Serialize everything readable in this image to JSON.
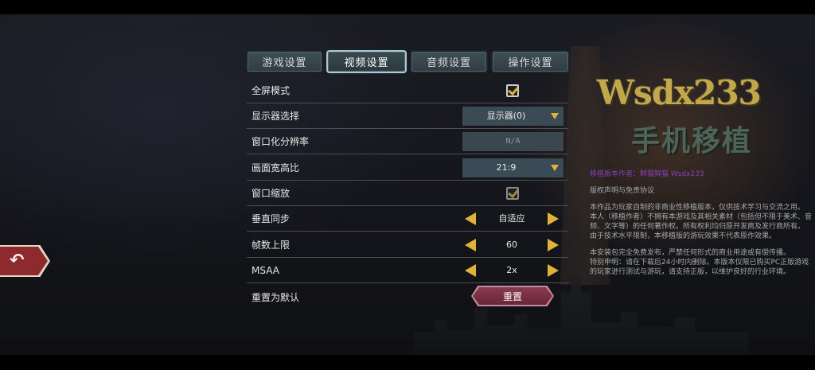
{
  "tabs": [
    {
      "label": "游戏设置",
      "active": false
    },
    {
      "label": "视频设置",
      "active": true
    },
    {
      "label": "音频设置",
      "active": false
    },
    {
      "label": "操作设置",
      "active": false
    }
  ],
  "settings": {
    "fullscreen": {
      "label": "全屏模式",
      "checked": true
    },
    "display": {
      "label": "显示器选择",
      "value": "显示器(0)"
    },
    "window_resolution": {
      "label": "窗口化分辨率",
      "value": "N/A"
    },
    "aspect_ratio": {
      "label": "画面宽高比",
      "value": "21:9"
    },
    "window_scale": {
      "label": "窗口缩放",
      "checked": true
    },
    "vsync": {
      "label": "垂直同步",
      "value": "自适应"
    },
    "fps_limit": {
      "label": "帧数上限",
      "value": "60"
    },
    "msaa": {
      "label": "MSAA",
      "value": "2x"
    },
    "reset": {
      "label": "重置为默认",
      "button": "重置"
    }
  },
  "logo": {
    "main": "Wsdx233",
    "sub": "手机移植"
  },
  "notice": {
    "author": "移植版本作者：鲜猫鲜猫 Wsdx233",
    "heading": "版权声明与免责协议",
    "p1": "本作品为玩家自制的非商业性移植版本，仅供技术学习与交流之用。",
    "p2": "本人（移植作者）不拥有本游戏及其相关素材（包括但不限于美术、音频、文字等）的任何著作权。所有权利均归原开发商及发行商所有。",
    "p3": "由于技术水平限制，本移植版的游玩效果不代表原作效果。",
    "p4": "本安装包完全免费发布，严禁任何形式的商业用途或有偿传播。",
    "p5": "特别申明：请在下载后24小时内删除。本版本仅限已购买PC正版游戏的玩家进行测试与游玩，请支持正版，以维护良好的行业环境。"
  },
  "colors": {
    "accent": "#e0b23a",
    "reset_button": "#8a3a50",
    "back_button": "#8e2a2e"
  }
}
